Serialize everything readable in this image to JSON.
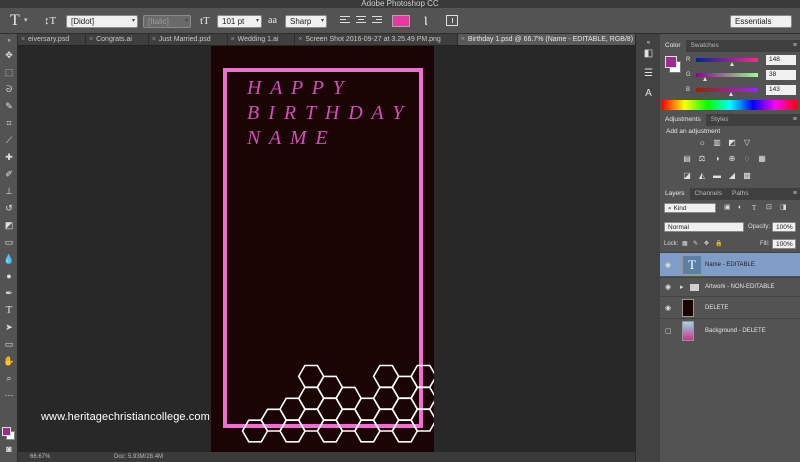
{
  "app": {
    "title": "Adobe Photoshop CC"
  },
  "options": {
    "tool_glyph": "T",
    "orient_glyph": "↕T",
    "font_family": "[Didot]",
    "font_style": "[Italic]",
    "size_glyph": "tT",
    "font_size": "101 pt",
    "aa_glyph": "aa",
    "antialias": "Sharp",
    "text_color": "#e33a9f",
    "workspace": "Essentials"
  },
  "tabs": [
    {
      "label": "eiversary.psd",
      "active": false
    },
    {
      "label": "Congrats.ai",
      "active": false
    },
    {
      "label": "Just Married.psd",
      "active": false
    },
    {
      "label": "Wedding 1.ai",
      "active": false
    },
    {
      "label": "Screen Shot 2016-09-27 at 3.25.49 PM.png",
      "active": false
    },
    {
      "label": "Birthday 1.psd @ 66.7% (Name - EDITABLE, RGB/8)",
      "active": true
    }
  ],
  "tab_close_glyph": "×",
  "canvas": {
    "headline_lines": [
      "H A P P Y",
      "B I R T H D A Y",
      "N A M E"
    ],
    "headline_color": "#d04fba",
    "frame_color": "#ee6fd2",
    "background_color": "#1a0404",
    "hex_color": "#ffffff"
  },
  "status": {
    "zoom": "66.67%",
    "doc": "Doc: 5.93M/28.4M"
  },
  "color_panel": {
    "tabs": [
      "Color",
      "Swatches"
    ],
    "channels": [
      {
        "label": "R",
        "value": "148"
      },
      {
        "label": "G",
        "value": "38"
      },
      {
        "label": "B",
        "value": "143"
      }
    ],
    "foreground": "#9b2d8f",
    "background": "#ffffff"
  },
  "adjustments_panel": {
    "tabs": [
      "Adjustments",
      "Styles"
    ],
    "title": "Add an adjustment",
    "row1": [
      "☼",
      "▥",
      "◩",
      "▽"
    ],
    "row2": [
      "▤",
      "⚖",
      "◑",
      "⊕",
      "◌",
      "▦"
    ],
    "row3": [
      "◪",
      "◭",
      "▬",
      "◢",
      "▩"
    ]
  },
  "layers_panel": {
    "tabs": [
      "Layers",
      "Channels",
      "Paths"
    ],
    "filter": "Kind",
    "filter_icons": [
      "▣",
      "◐",
      "T",
      "⊡",
      "◨"
    ],
    "blend_mode": "Normal",
    "opacity_label": "Opacity:",
    "opacity": "100%",
    "lock_label": "Lock:",
    "lock_icons": [
      "▦",
      "✎",
      "✥",
      "🔒"
    ],
    "fill_label": "Fill:",
    "fill": "100%",
    "thumb_glyph": "T",
    "folder_glyph": "▸",
    "layers": [
      {
        "name": "Name - EDITABLE",
        "visible": true,
        "selected": true,
        "kind": "text"
      },
      {
        "name": "Artwork - NON-EDITABLE",
        "visible": true,
        "selected": false,
        "kind": "group"
      },
      {
        "name": "DELETE",
        "visible": true,
        "selected": false,
        "kind": "pixel"
      },
      {
        "name": "Background - DELETE",
        "visible": false,
        "selected": false,
        "kind": "image"
      }
    ]
  },
  "watermark": "www.heritagechristiancollege.com"
}
